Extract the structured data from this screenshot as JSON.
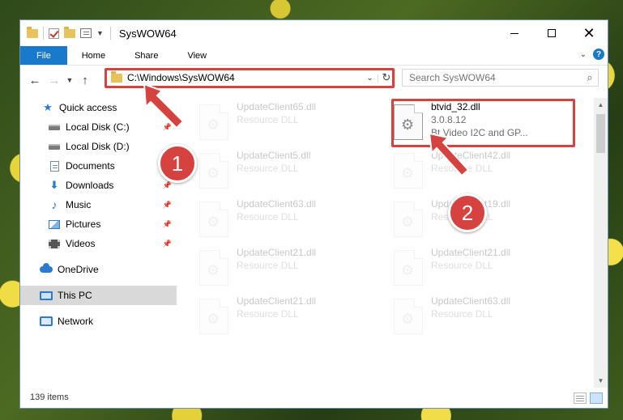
{
  "window": {
    "title": "SysWOW64",
    "minimize_icon": "minimize-icon",
    "maximize_icon": "maximize-icon",
    "close_icon": "close-icon"
  },
  "ribbon": {
    "tabs": [
      "File",
      "Home",
      "Share",
      "View"
    ],
    "help_label": "?"
  },
  "address": {
    "path": "C:\\Windows\\SysWOW64",
    "search_placeholder": "Search SysWOW64"
  },
  "sidebar": {
    "items": [
      {
        "label": "Quick access",
        "icon": "star-icon"
      },
      {
        "label": "Local Disk (C:)",
        "icon": "disk-icon",
        "pinned": true
      },
      {
        "label": "Local Disk (D:)",
        "icon": "disk-icon"
      },
      {
        "label": "Documents",
        "icon": "document-icon",
        "pinned": true
      },
      {
        "label": "Downloads",
        "icon": "download-icon",
        "pinned": true
      },
      {
        "label": "Music",
        "icon": "music-icon",
        "pinned": true
      },
      {
        "label": "Pictures",
        "icon": "pictures-icon",
        "pinned": true
      },
      {
        "label": "Videos",
        "icon": "videos-icon",
        "pinned": true
      },
      {
        "label": "OneDrive",
        "icon": "cloud-icon"
      },
      {
        "label": "This PC",
        "icon": "computer-icon",
        "selected": true
      },
      {
        "label": "Network",
        "icon": "network-icon"
      }
    ]
  },
  "files": {
    "left_column": [
      {
        "name": "UpdateClient65.dll",
        "type": "Resource DLL"
      },
      {
        "name": "UpdateClient5.dll",
        "type": "Resource DLL"
      },
      {
        "name": "UpdateClient63.dll",
        "type": "Resource DLL"
      },
      {
        "name": "UpdateClient21.dll",
        "type": "Resource DLL"
      },
      {
        "name": "UpdateClient21.dll",
        "type": "Resource DLL"
      }
    ],
    "selected": {
      "name": "btvid_32.dll",
      "version": "3.0.8.12",
      "description": "Bt Video I2C and GP..."
    },
    "right_column": [
      {
        "name": "UpdateClient42.dll",
        "type": "Resource DLL"
      },
      {
        "name": "UpdateClient19.dll",
        "type": "Resource DLL"
      },
      {
        "name": "UpdateClient21.dll",
        "type": "Resource DLL"
      },
      {
        "name": "UpdateClient63.dll",
        "type": "Resource DLL"
      }
    ]
  },
  "status": {
    "item_count": "139 items"
  },
  "callouts": {
    "one": "1",
    "two": "2"
  },
  "colors": {
    "accent": "#1979ca",
    "highlight": "#d6423f",
    "selected_bg": "#d9d9d9"
  }
}
